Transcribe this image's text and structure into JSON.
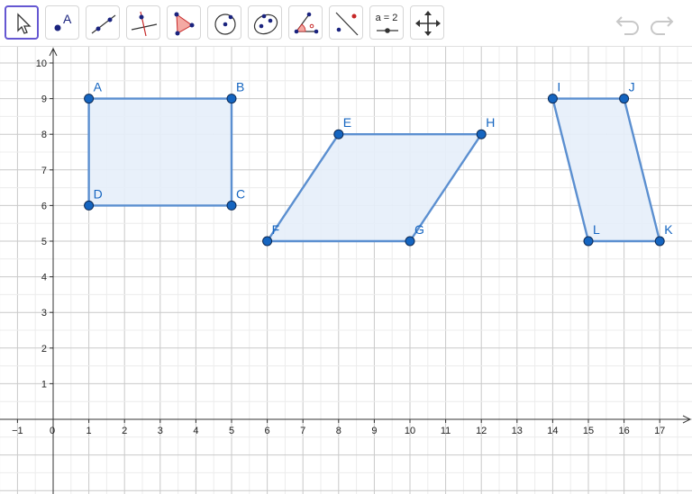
{
  "toolbar": {
    "tools": [
      {
        "name": "move-tool",
        "icon": "arrow-cursor-icon",
        "active": true
      },
      {
        "name": "point-tool",
        "icon": "point-icon",
        "label": "A"
      },
      {
        "name": "line-tool",
        "icon": "line-icon"
      },
      {
        "name": "perpendicular-line-tool",
        "icon": "perpendicular-icon"
      },
      {
        "name": "polygon-tool",
        "icon": "polygon-icon"
      },
      {
        "name": "circle-tool",
        "icon": "circle-icon"
      },
      {
        "name": "conic-tool",
        "icon": "ellipse-icon"
      },
      {
        "name": "angle-tool",
        "icon": "angle-icon"
      },
      {
        "name": "reflect-tool",
        "icon": "reflect-icon"
      },
      {
        "name": "slider-tool",
        "icon": "slider-icon",
        "label": "a = 2"
      },
      {
        "name": "move-graphics-view-tool",
        "icon": "move-view-icon"
      }
    ],
    "undo_icon": "undo-icon",
    "redo_icon": "redo-icon"
  },
  "colors": {
    "accent": "#6557d2",
    "polygon_stroke": "#5b8fd0",
    "polygon_fill": "#e6eef9",
    "point_fill": "#1565c0",
    "label": "#1565c0",
    "grid": "#d0d0d0"
  },
  "axes": {
    "x_range": [
      -1,
      17
    ],
    "y_range": [
      1,
      10
    ],
    "x_tick_labels": [
      "−1",
      "0",
      "1",
      "2",
      "3",
      "4",
      "5",
      "6",
      "7",
      "8",
      "9",
      "10",
      "11",
      "12",
      "13",
      "14",
      "15",
      "16",
      "17"
    ],
    "y_tick_labels": [
      "1",
      "2",
      "3",
      "4",
      "5",
      "6",
      "7",
      "8",
      "9",
      "10"
    ]
  },
  "points": [
    {
      "label": "A",
      "x": 1,
      "y": 9
    },
    {
      "label": "B",
      "x": 5,
      "y": 9
    },
    {
      "label": "C",
      "x": 5,
      "y": 6
    },
    {
      "label": "D",
      "x": 1,
      "y": 6
    },
    {
      "label": "E",
      "x": 8,
      "y": 8
    },
    {
      "label": "H",
      "x": 12,
      "y": 8
    },
    {
      "label": "G",
      "x": 10,
      "y": 5
    },
    {
      "label": "F",
      "x": 6,
      "y": 5
    },
    {
      "label": "I",
      "x": 14,
      "y": 9
    },
    {
      "label": "J",
      "x": 16,
      "y": 9
    },
    {
      "label": "K",
      "x": 17,
      "y": 5
    },
    {
      "label": "L",
      "x": 15,
      "y": 5
    }
  ],
  "polygons": [
    {
      "vertices": [
        "A",
        "B",
        "C",
        "D"
      ]
    },
    {
      "vertices": [
        "E",
        "H",
        "G",
        "F"
      ]
    },
    {
      "vertices": [
        "I",
        "J",
        "K",
        "L"
      ]
    }
  ]
}
